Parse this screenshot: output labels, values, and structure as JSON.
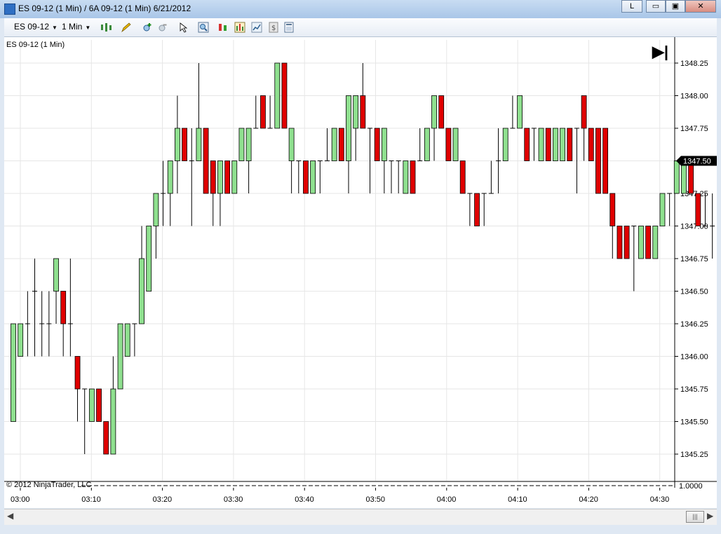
{
  "window": {
    "title": "ES 09-12 (1 Min) / 6A 09-12 (1 Min)  6/21/2012",
    "btn_l": "L",
    "btn_min": "▭",
    "btn_max": "▣",
    "btn_close": "✕"
  },
  "toolbar": {
    "instrument": "ES 09-12",
    "interval": "1 Min",
    "icons": [
      "candlestick-icon",
      "pencil-icon",
      "zoom-in-icon",
      "zoom-out-icon",
      "cursor-icon",
      "magnifier-icon",
      "strategy-icon",
      "bars-icon",
      "chart-icon",
      "dollar-icon",
      "properties-icon"
    ]
  },
  "chart": {
    "label": "ES 09-12 (1 Min)",
    "copyright": "© 2012 NinjaTrader, LLC",
    "scroll_end_icon": "scroll-to-end-icon",
    "last_price_label": "1347.50",
    "lower_axis_label": "1.0000"
  },
  "chart_data": {
    "type": "candlestick",
    "price_ticks": [
      "1348.25",
      "1348.00",
      "1347.75",
      "1347.50",
      "1347.25",
      "1347.00",
      "1346.75",
      "1346.50",
      "1346.25",
      "1346.00",
      "1345.75",
      "1345.50",
      "1345.25"
    ],
    "ylim": [
      1345.125,
      1348.375
    ],
    "time_ticks": [
      "03:00",
      "03:10",
      "03:20",
      "03:30",
      "03:40",
      "03:50",
      "04:00",
      "04:10",
      "04:20",
      "04:30"
    ],
    "up_color": "#8fe08f",
    "down_color": "#e00000",
    "candles": [
      {
        "o": 1345.5,
        "h": 1346.25,
        "l": 1345.5,
        "c": 1346.25
      },
      {
        "o": 1346.0,
        "h": 1346.25,
        "l": 1346.0,
        "c": 1346.25
      },
      {
        "o": 1346.25,
        "h": 1346.5,
        "l": 1346.0,
        "c": 1346.25
      },
      {
        "o": 1346.5,
        "h": 1346.75,
        "l": 1346.0,
        "c": 1346.5
      },
      {
        "o": 1346.25,
        "h": 1346.5,
        "l": 1346.0,
        "c": 1346.25
      },
      {
        "o": 1346.25,
        "h": 1346.5,
        "l": 1346.0,
        "c": 1346.25
      },
      {
        "o": 1346.5,
        "h": 1346.75,
        "l": 1346.25,
        "c": 1346.75
      },
      {
        "o": 1346.5,
        "h": 1346.5,
        "l": 1346.0,
        "c": 1346.25
      },
      {
        "o": 1346.25,
        "h": 1346.75,
        "l": 1346.0,
        "c": 1346.25
      },
      {
        "o": 1346.0,
        "h": 1346.0,
        "l": 1345.5,
        "c": 1345.75
      },
      {
        "o": 1345.75,
        "h": 1345.75,
        "l": 1345.25,
        "c": 1345.75
      },
      {
        "o": 1345.5,
        "h": 1345.75,
        "l": 1345.5,
        "c": 1345.75
      },
      {
        "o": 1345.75,
        "h": 1345.75,
        "l": 1345.5,
        "c": 1345.5
      },
      {
        "o": 1345.5,
        "h": 1345.5,
        "l": 1345.25,
        "c": 1345.25
      },
      {
        "o": 1345.25,
        "h": 1346.0,
        "l": 1345.25,
        "c": 1345.75
      },
      {
        "o": 1345.75,
        "h": 1346.25,
        "l": 1345.75,
        "c": 1346.25
      },
      {
        "o": 1346.0,
        "h": 1346.25,
        "l": 1346.0,
        "c": 1346.25
      },
      {
        "o": 1346.25,
        "h": 1346.25,
        "l": 1346.0,
        "c": 1346.25
      },
      {
        "o": 1346.25,
        "h": 1347.0,
        "l": 1346.25,
        "c": 1346.75
      },
      {
        "o": 1346.5,
        "h": 1347.0,
        "l": 1346.5,
        "c": 1347.0
      },
      {
        "o": 1347.0,
        "h": 1347.25,
        "l": 1346.75,
        "c": 1347.25
      },
      {
        "o": 1347.25,
        "h": 1347.5,
        "l": 1347.0,
        "c": 1347.25
      },
      {
        "o": 1347.25,
        "h": 1347.5,
        "l": 1347.0,
        "c": 1347.5
      },
      {
        "o": 1347.5,
        "h": 1348.0,
        "l": 1347.25,
        "c": 1347.75
      },
      {
        "o": 1347.75,
        "h": 1347.75,
        "l": 1347.5,
        "c": 1347.5
      },
      {
        "o": 1347.5,
        "h": 1347.75,
        "l": 1347.0,
        "c": 1347.5
      },
      {
        "o": 1347.5,
        "h": 1348.25,
        "l": 1347.5,
        "c": 1347.75
      },
      {
        "o": 1347.75,
        "h": 1347.75,
        "l": 1347.25,
        "c": 1347.25
      },
      {
        "o": 1347.5,
        "h": 1347.5,
        "l": 1347.0,
        "c": 1347.25
      },
      {
        "o": 1347.25,
        "h": 1347.5,
        "l": 1347.0,
        "c": 1347.5
      },
      {
        "o": 1347.5,
        "h": 1347.5,
        "l": 1347.25,
        "c": 1347.25
      },
      {
        "o": 1347.25,
        "h": 1347.5,
        "l": 1347.25,
        "c": 1347.5
      },
      {
        "o": 1347.5,
        "h": 1347.75,
        "l": 1347.5,
        "c": 1347.75
      },
      {
        "o": 1347.5,
        "h": 1347.75,
        "l": 1347.25,
        "c": 1347.75
      },
      {
        "o": 1347.75,
        "h": 1348.0,
        "l": 1347.75,
        "c": 1347.75
      },
      {
        "o": 1348.0,
        "h": 1348.0,
        "l": 1347.75,
        "c": 1347.75
      },
      {
        "o": 1347.75,
        "h": 1348.0,
        "l": 1347.75,
        "c": 1347.75
      },
      {
        "o": 1347.75,
        "h": 1348.25,
        "l": 1347.75,
        "c": 1348.25
      },
      {
        "o": 1348.25,
        "h": 1348.25,
        "l": 1347.75,
        "c": 1347.75
      },
      {
        "o": 1347.5,
        "h": 1347.75,
        "l": 1347.25,
        "c": 1347.75
      },
      {
        "o": 1347.5,
        "h": 1347.5,
        "l": 1347.25,
        "c": 1347.5
      },
      {
        "o": 1347.5,
        "h": 1347.5,
        "l": 1347.25,
        "c": 1347.25
      },
      {
        "o": 1347.25,
        "h": 1347.5,
        "l": 1347.25,
        "c": 1347.5
      },
      {
        "o": 1347.5,
        "h": 1347.5,
        "l": 1347.25,
        "c": 1347.5
      },
      {
        "o": 1347.5,
        "h": 1347.75,
        "l": 1347.5,
        "c": 1347.5
      },
      {
        "o": 1347.5,
        "h": 1347.75,
        "l": 1347.5,
        "c": 1347.75
      },
      {
        "o": 1347.75,
        "h": 1347.75,
        "l": 1347.5,
        "c": 1347.5
      },
      {
        "o": 1347.5,
        "h": 1348.0,
        "l": 1347.25,
        "c": 1348.0
      },
      {
        "o": 1347.75,
        "h": 1348.0,
        "l": 1347.5,
        "c": 1348.0
      },
      {
        "o": 1348.0,
        "h": 1348.25,
        "l": 1347.75,
        "c": 1347.75
      },
      {
        "o": 1347.75,
        "h": 1347.75,
        "l": 1347.25,
        "c": 1347.75
      },
      {
        "o": 1347.75,
        "h": 1347.75,
        "l": 1347.5,
        "c": 1347.5
      },
      {
        "o": 1347.5,
        "h": 1347.75,
        "l": 1347.25,
        "c": 1347.75
      },
      {
        "o": 1347.5,
        "h": 1347.5,
        "l": 1347.25,
        "c": 1347.5
      },
      {
        "o": 1347.5,
        "h": 1347.5,
        "l": 1347.25,
        "c": 1347.5
      },
      {
        "o": 1347.25,
        "h": 1347.5,
        "l": 1347.25,
        "c": 1347.5
      },
      {
        "o": 1347.5,
        "h": 1347.5,
        "l": 1347.25,
        "c": 1347.25
      },
      {
        "o": 1347.5,
        "h": 1347.75,
        "l": 1347.5,
        "c": 1347.5
      },
      {
        "o": 1347.5,
        "h": 1347.75,
        "l": 1347.5,
        "c": 1347.75
      },
      {
        "o": 1347.75,
        "h": 1348.0,
        "l": 1347.5,
        "c": 1348.0
      },
      {
        "o": 1348.0,
        "h": 1348.0,
        "l": 1347.75,
        "c": 1347.75
      },
      {
        "o": 1347.75,
        "h": 1347.75,
        "l": 1347.5,
        "c": 1347.5
      },
      {
        "o": 1347.5,
        "h": 1347.75,
        "l": 1347.5,
        "c": 1347.75
      },
      {
        "o": 1347.5,
        "h": 1347.5,
        "l": 1347.25,
        "c": 1347.25
      },
      {
        "o": 1347.25,
        "h": 1347.25,
        "l": 1347.0,
        "c": 1347.25
      },
      {
        "o": 1347.25,
        "h": 1347.25,
        "l": 1347.0,
        "c": 1347.0
      },
      {
        "o": 1347.25,
        "h": 1347.25,
        "l": 1347.0,
        "c": 1347.25
      },
      {
        "o": 1347.25,
        "h": 1347.5,
        "l": 1347.25,
        "c": 1347.25
      },
      {
        "o": 1347.5,
        "h": 1347.75,
        "l": 1347.25,
        "c": 1347.5
      },
      {
        "o": 1347.5,
        "h": 1347.75,
        "l": 1347.5,
        "c": 1347.75
      },
      {
        "o": 1347.75,
        "h": 1348.0,
        "l": 1347.75,
        "c": 1347.75
      },
      {
        "o": 1347.75,
        "h": 1348.0,
        "l": 1347.75,
        "c": 1348.0
      },
      {
        "o": 1347.75,
        "h": 1347.75,
        "l": 1347.5,
        "c": 1347.5
      },
      {
        "o": 1347.75,
        "h": 1347.75,
        "l": 1347.5,
        "c": 1347.75
      },
      {
        "o": 1347.5,
        "h": 1347.75,
        "l": 1347.5,
        "c": 1347.75
      },
      {
        "o": 1347.75,
        "h": 1347.75,
        "l": 1347.5,
        "c": 1347.5
      },
      {
        "o": 1347.5,
        "h": 1347.75,
        "l": 1347.5,
        "c": 1347.75
      },
      {
        "o": 1347.5,
        "h": 1347.75,
        "l": 1347.5,
        "c": 1347.75
      },
      {
        "o": 1347.75,
        "h": 1347.75,
        "l": 1347.5,
        "c": 1347.5
      },
      {
        "o": 1347.75,
        "h": 1347.75,
        "l": 1347.25,
        "c": 1347.75
      },
      {
        "o": 1348.0,
        "h": 1348.0,
        "l": 1347.5,
        "c": 1347.75
      },
      {
        "o": 1347.75,
        "h": 1347.75,
        "l": 1347.5,
        "c": 1347.5
      },
      {
        "o": 1347.75,
        "h": 1347.75,
        "l": 1347.25,
        "c": 1347.25
      },
      {
        "o": 1347.75,
        "h": 1347.75,
        "l": 1347.25,
        "c": 1347.25
      },
      {
        "o": 1347.25,
        "h": 1347.25,
        "l": 1346.75,
        "c": 1347.0
      },
      {
        "o": 1347.0,
        "h": 1347.0,
        "l": 1346.75,
        "c": 1346.75
      },
      {
        "o": 1347.0,
        "h": 1347.0,
        "l": 1346.75,
        "c": 1346.75
      },
      {
        "o": 1347.0,
        "h": 1347.0,
        "l": 1346.5,
        "c": 1347.0
      },
      {
        "o": 1346.75,
        "h": 1347.0,
        "l": 1346.75,
        "c": 1347.0
      },
      {
        "o": 1347.0,
        "h": 1347.0,
        "l": 1346.75,
        "c": 1346.75
      },
      {
        "o": 1346.75,
        "h": 1347.0,
        "l": 1346.75,
        "c": 1347.0
      },
      {
        "o": 1347.0,
        "h": 1347.25,
        "l": 1347.0,
        "c": 1347.25
      },
      {
        "o": 1347.25,
        "h": 1347.25,
        "l": 1347.0,
        "c": 1347.25
      },
      {
        "o": 1347.25,
        "h": 1347.5,
        "l": 1347.25,
        "c": 1347.5
      },
      {
        "o": 1347.25,
        "h": 1347.5,
        "l": 1347.25,
        "c": 1347.5
      },
      {
        "o": 1347.5,
        "h": 1347.5,
        "l": 1347.25,
        "c": 1347.25
      },
      {
        "o": 1347.25,
        "h": 1347.25,
        "l": 1347.0,
        "c": 1347.0
      },
      {
        "o": 1347.0,
        "h": 1347.25,
        "l": 1347.0,
        "c": 1347.0
      },
      {
        "o": 1347.0,
        "h": 1347.25,
        "l": 1346.75,
        "c": 1347.0
      },
      {
        "o": 1347.25,
        "h": 1347.5,
        "l": 1347.25,
        "c": 1347.25
      },
      {
        "o": 1347.25,
        "h": 1347.5,
        "l": 1347.25,
        "c": 1347.5
      }
    ]
  }
}
